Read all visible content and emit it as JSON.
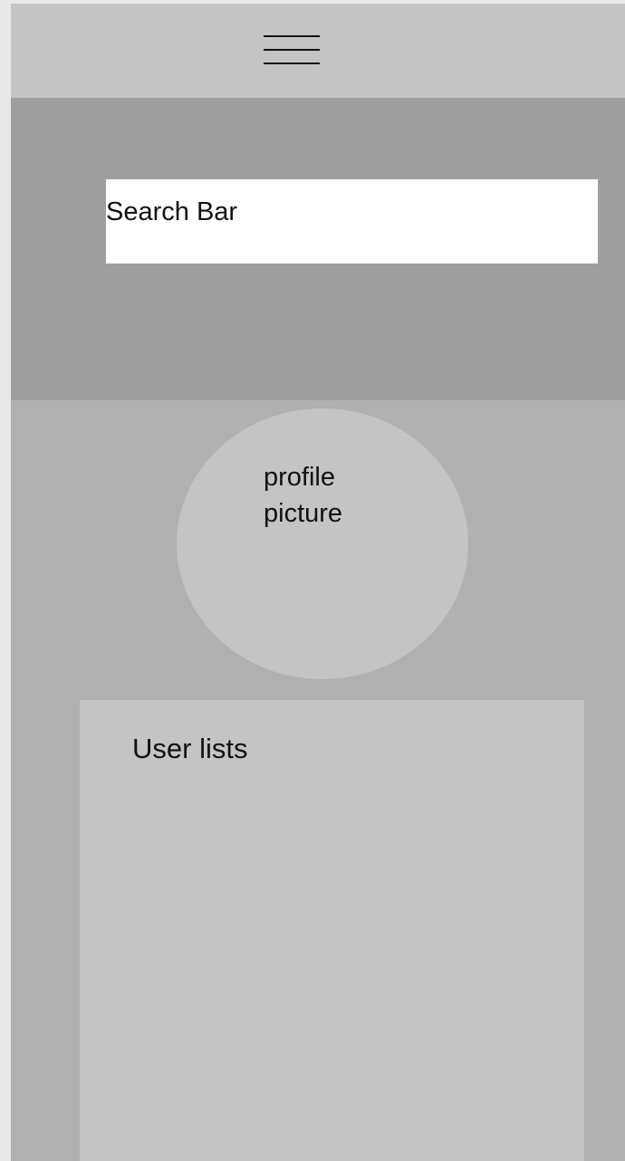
{
  "top_bar": {
    "menu_icon": "hamburger-menu-icon"
  },
  "search": {
    "label": "Search Bar",
    "placeholder": "Search Bar",
    "value": ""
  },
  "profile": {
    "line1": "profile",
    "line2": "picture"
  },
  "user_lists": {
    "title": "User lists"
  },
  "colors": {
    "page_background": "#e8e8e8",
    "top_bar": "#c4c4c4",
    "header_panel": "#9f9d9f",
    "content_background": "#b0b0b0",
    "card": "#c4c4c4",
    "search_field": "#ffffff",
    "text": "#111111"
  }
}
